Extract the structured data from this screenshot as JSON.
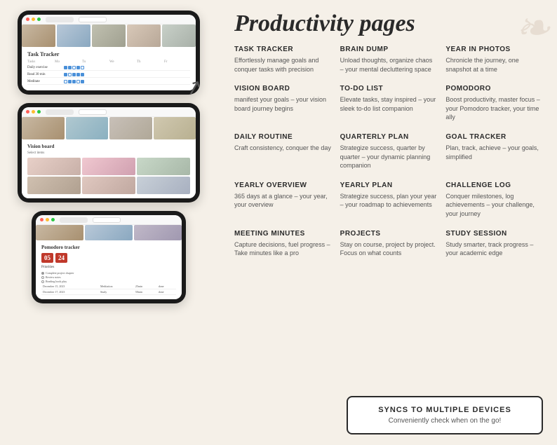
{
  "page": {
    "title": "Productivity pages",
    "background_color": "#f5f0e8"
  },
  "header": {
    "title_part1": "Productivity",
    "title_part2": "pages"
  },
  "features": [
    {
      "id": "task-tracker",
      "title": "TASK TRACKER",
      "description": "Effortlessly manage goals and conquer tasks with precision"
    },
    {
      "id": "brain-dump",
      "title": "BRAIN DUMP",
      "description": "Unload thoughts, organize chaos – your mental decluttering space"
    },
    {
      "id": "year-in-photos",
      "title": "YEAR IN PHOTOS",
      "description": "Chronicle the journey, one snapshot at a time"
    },
    {
      "id": "vision-board",
      "title": "VISION BOARD",
      "description": "manifest your goals – your vision board journey begins"
    },
    {
      "id": "to-do-list",
      "title": "TO-DO LIST",
      "description": "Elevate tasks, stay inspired – your sleek to-do list companion"
    },
    {
      "id": "pomodoro",
      "title": "POMODORO",
      "description": "Boost productivity, master focus – your Pomodoro tracker, your time ally"
    },
    {
      "id": "daily-routine",
      "title": "DAILY ROUTINE",
      "description": "Craft consistency, conquer the day"
    },
    {
      "id": "quarterly-plan",
      "title": "QUARTERLY PLAN",
      "description": "Strategize success, quarter by quarter – your dynamic planning companion"
    },
    {
      "id": "goal-tracker",
      "title": "GOAL TRACKER",
      "description": "Plan, track, achieve – your goals, simplified"
    },
    {
      "id": "yearly-overview",
      "title": "YEARLY OVERVIEW",
      "description": "365 days at a glance – your year, your overview"
    },
    {
      "id": "yearly-plan",
      "title": "YEARLY PLAN",
      "description": "Strategize success, plan your year – your roadmap to achievements"
    },
    {
      "id": "challenge-log",
      "title": "CHALLENGE LOG",
      "description": "Conquer milestones, log achievements – your challenge, your journey"
    },
    {
      "id": "meeting-minutes",
      "title": "MEETING MINUTES",
      "description": "Capture decisions, fuel progress – Take minutes like a pro"
    },
    {
      "id": "projects",
      "title": "PROJECTS",
      "description": "Stay on course, project by project. Focus on what counts"
    },
    {
      "id": "study-session",
      "title": "STUDY SESSION",
      "description": "Study smarter, track progress – your academic edge"
    }
  ],
  "cta": {
    "title": "SYNCS TO MULTIPLE DEVICES",
    "description": "Conveniently check when on the go!"
  },
  "tablets": {
    "task_tracker_title": "Task Tracker",
    "vision_board_title": "Vision board",
    "pomodoro_title": "Pomodoro tracker"
  },
  "pomodoro": {
    "minutes": "05",
    "seconds": "24"
  }
}
